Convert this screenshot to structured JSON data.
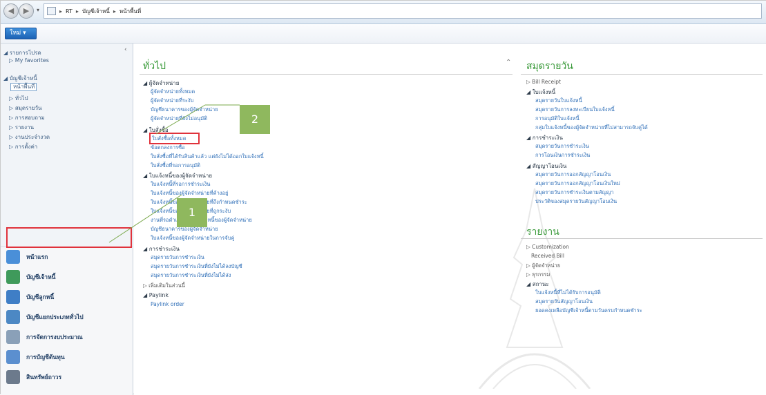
{
  "address_bar": {
    "crumbs": [
      "RT",
      "บัญชีเจ้าหนี้",
      "หน้าพื้นที่"
    ]
  },
  "ribbon": {
    "new_label": "ใหม่ ▾"
  },
  "nav": {
    "favorites": "รายการโปรด",
    "my_favorites": "My favorites",
    "section": "บัญชีเจ้าหนี้",
    "items": [
      "หน้าพื้นที่",
      "ทั่วไป",
      "สมุดรายวัน",
      "การสอบถาม",
      "รายงาน",
      "งานประจำงวด",
      "การตั้งค่า"
    ],
    "modules": [
      {
        "label": "หน้าแรก",
        "color": "#4a8fd8"
      },
      {
        "label": "บัญชีเจ้าหนี้",
        "color": "#3f9a5b"
      },
      {
        "label": "บัญชีลูกหนี้",
        "color": "#3f7ec6"
      },
      {
        "label": "บัญชีแยกประเภททั่วไป",
        "color": "#4c88c4"
      },
      {
        "label": "การจัดการงบประมาณ",
        "color": "#8aa0b8"
      },
      {
        "label": "การบัญชีต้นทุน",
        "color": "#5b8fcf"
      },
      {
        "label": "สินทรัพย์ถาวร",
        "color": "#6c7a8c"
      }
    ]
  },
  "general": {
    "title": "ทั่วไป",
    "g1": "ผู้จัดจำหน่าย",
    "g1_links": [
      "ผู้จัดจำหน่ายทั้งหมด",
      "ผู้จัดจำหน่ายที่ระงับ",
      "บัญชีธนาคารของผู้จัดจำหน่าย",
      "ผู้จัดจำหน่ายที่ยังไม่อนุมัติ"
    ],
    "g2": "ใบสั่งซื้อ",
    "g2_links": [
      "ใบสั่งซื้อทั้งหมด",
      "ข้อตกลงการซื้อ",
      "ใบสั่งซื้อที่ได้รับสินค้าแล้ว แต่ยังไม่ได้ออกใบแจ้งหนี้",
      "ใบสั่งซื้อที่รอการอนุมัติ"
    ],
    "g3": "ใบแจ้งหนี้ของผู้จัดจำหน่าย",
    "g3_links": [
      "ใบแจ้งหนี้ที่รอการชำระเงิน",
      "ใบแจ้งหนี้ของผู้จัดจำหน่ายที่ค้างอยู่",
      "ใบแจ้งหนี้ของผู้จัดจำหน่ายที่ถึงกำหนดชำระ",
      "ใบแจ้งหนี้ของผู้จัดจำหน่ายที่ถูกระงับ",
      "งานที่รอดำเนินการใบแจ้งหนี้ของผู้จัดจำหน่าย",
      "บัญชีธนาคารของผู้จัดจำหน่าย",
      "ใบแจ้งหนี้ของผู้จัดจำหน่ายในการจับคู่"
    ],
    "g4": "การชำระเงิน",
    "g4_links": [
      "สมุดรายวันการชำระเงิน",
      "สมุดรายวันการชำระเงินที่ยังไม่ได้ลงบัญชี",
      "สมุดรายวันการชำระเงินที่ยังไม่ได้ส่ง"
    ],
    "g5": "เพิ่มเติมในส่วนนี้",
    "g6": "Paylink",
    "g6_links": [
      "Paylink order"
    ]
  },
  "journals": {
    "title": "สมุดรายวัน",
    "bill": "Bill Receipt",
    "g1": "ใบแจ้งหนี้",
    "g1_links": [
      "สมุดรายวันใบแจ้งหนี้",
      "สมุดรายวันการลงทะเบียนใบแจ้งหนี้",
      "การอนุมัติใบแจ้งหนี้",
      "กลุ่มใบแจ้งหนี้ของผู้จัดจำหน่ายที่ไม่สามารถจับคู่ได้"
    ],
    "g2": "การชำระเงิน",
    "g2_links": [
      "สมุดรายวันการชำระเงิน",
      "การโอนเงินการชำระเงิน"
    ],
    "g3": "สัญญาโอนเงิน",
    "g3_links": [
      "สมุดรายวันการออกสัญญาโอนเงิน",
      "สมุดรายวันการออกสัญญาโอนเงินใหม่",
      "สมุดรายวันการชำระเงินตามสัญญา",
      "ประวัติของสมุดรายวันสัญญาโอนเงิน"
    ]
  },
  "reports": {
    "title": "รายงาน",
    "items": [
      "Customization",
      "Received Bill",
      "ผู้จัดจำหน่าย",
      "ธุรกรรม"
    ],
    "g": "สถานะ",
    "g_links": [
      "ใบแจ้งหนี้ที่ไม่ได้รับการอนุมัติ",
      "สมุดรายวันสัญญาโอนเงิน",
      "ยอดคงเหลือบัญชีเจ้าหนี้ตามวันครบกำหนดชำระ"
    ]
  },
  "callouts": {
    "one": "1",
    "two": "2"
  }
}
